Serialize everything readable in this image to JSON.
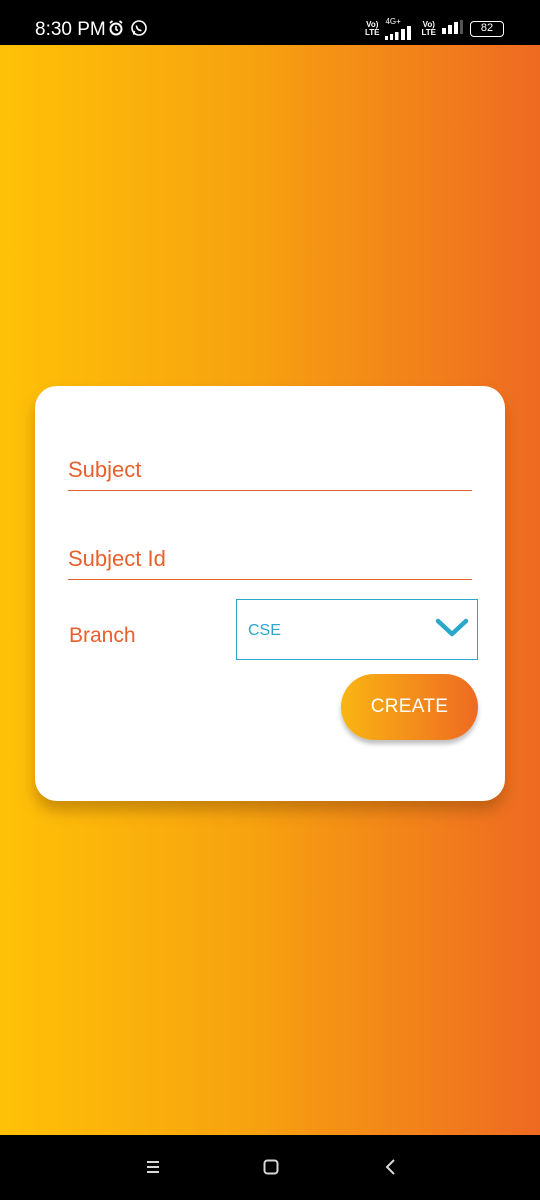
{
  "status_bar": {
    "time": "8:30 PM",
    "volte_1": "Vo)\nLTE",
    "net_type": "4G+",
    "volte_2": "Vo)\nLTE",
    "battery": "82",
    "icons": [
      "alarm-icon",
      "whatsapp-icon",
      "signal-icon",
      "battery-icon"
    ]
  },
  "form": {
    "subject_placeholder": "Subject",
    "subject_value": "",
    "subject_id_placeholder": "Subject Id",
    "subject_id_value": "",
    "branch_label": "Branch",
    "branch_selected": "CSE",
    "create_label": "CREATE"
  },
  "colors": {
    "gradient_start": "#FFC107",
    "gradient_end": "#EE6A22",
    "accent_text": "#E8602C",
    "select_accent": "#2AA7C9"
  },
  "nav_bar": {
    "icons": [
      "menu-icon",
      "home-icon",
      "back-icon"
    ]
  }
}
